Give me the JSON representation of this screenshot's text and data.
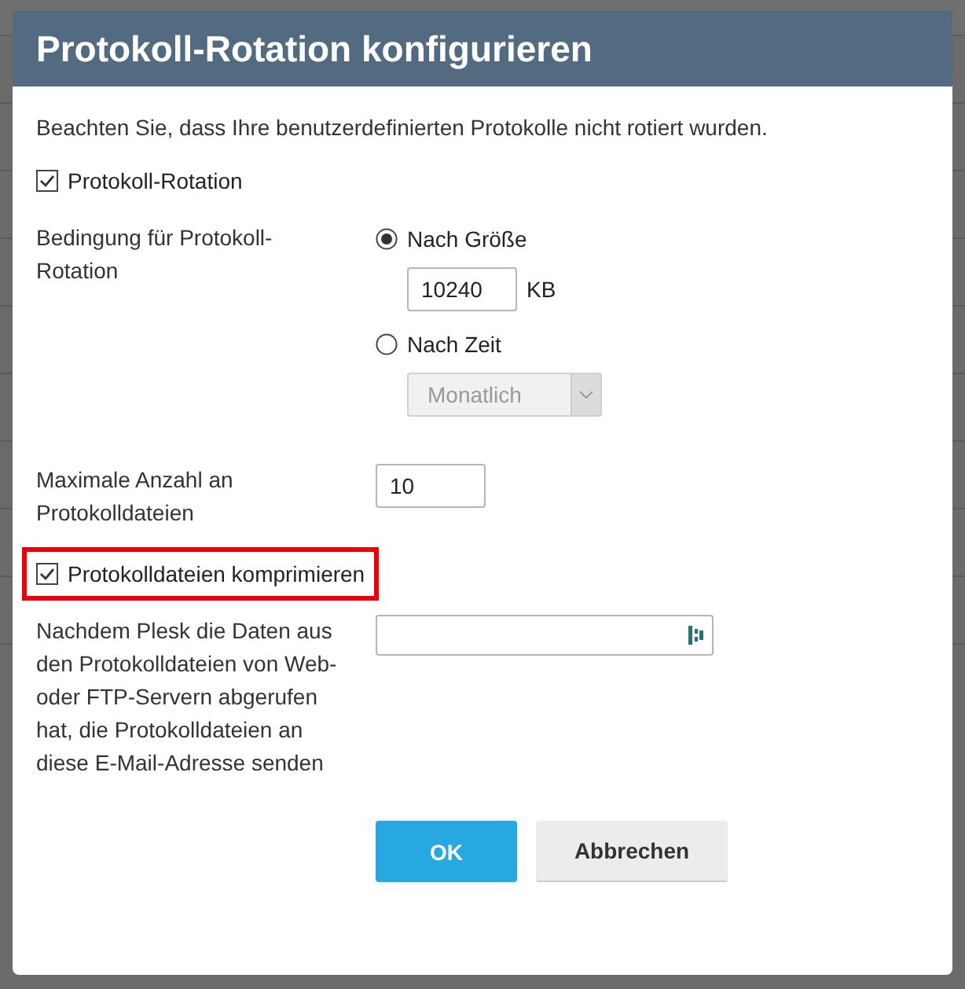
{
  "dialog": {
    "title": "Protokoll-Rotation konfigurieren",
    "notice": "Beachten Sie, dass Ihre benutzerdefinierten Protokolle nicht rotiert wurden.",
    "rows": [
      {
        "kind": "checkbox",
        "label": "Protokoll-Rotation",
        "checked": true,
        "highlighted": false
      },
      {
        "kind": "condition",
        "label": "Bedingung für Protokoll-Rotation",
        "options": [
          {
            "label": "Nach Größe",
            "selected": true,
            "value": "10240",
            "unit": "KB"
          },
          {
            "label": "Nach Zeit",
            "selected": false,
            "select": "Monatlich",
            "disabled": true
          }
        ]
      },
      {
        "kind": "number",
        "label": "Maximale Anzahl an Protokolldateien",
        "value": "10"
      },
      {
        "kind": "checkbox",
        "label": "Protokolldateien komprimieren",
        "checked": true,
        "highlighted": true
      },
      {
        "kind": "email",
        "label": "Nachdem Plesk die Daten aus den Protokolldateien von Web- oder FTP-Servern abgerufen hat, die Protokolldateien an diese E-Mail-Adresse senden"
      }
    ],
    "buttons": [
      {
        "label": "OK",
        "primary": true
      },
      {
        "label": "Abbrechen",
        "primary": false
      }
    ]
  }
}
